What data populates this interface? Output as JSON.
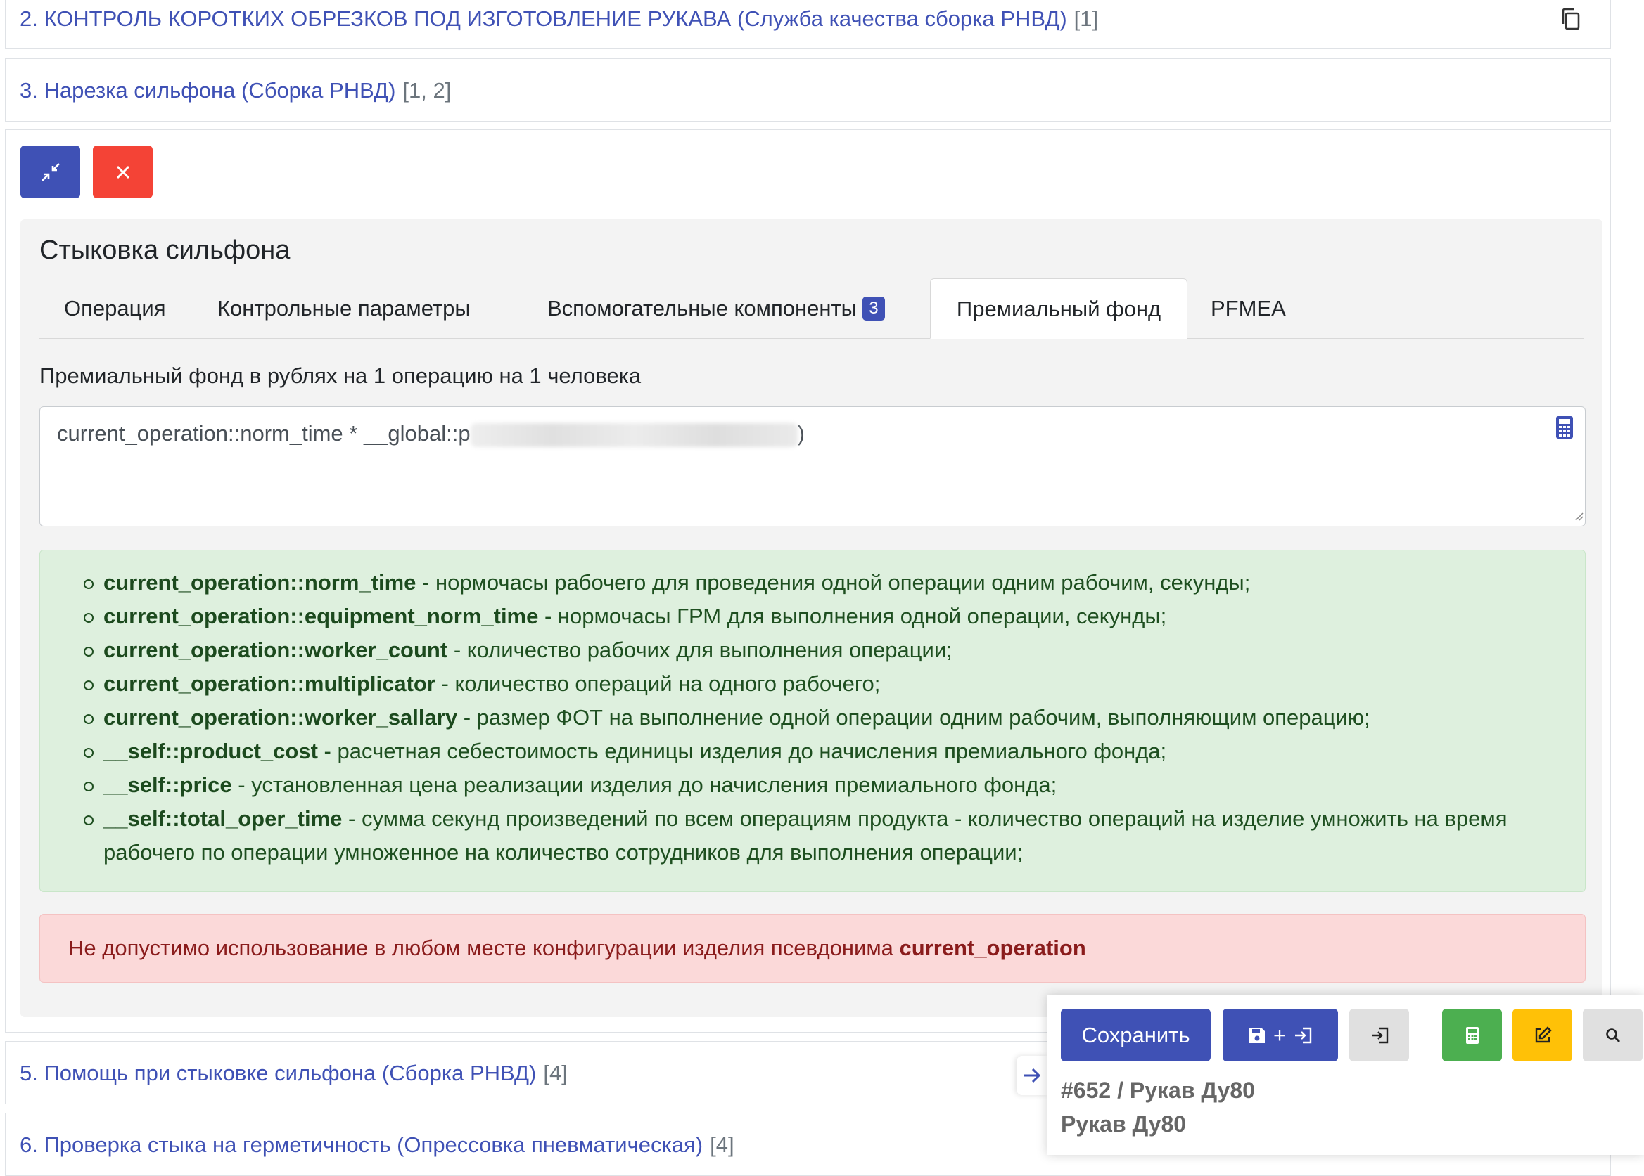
{
  "operations": [
    {
      "title": "2. КОНТРОЛЬ КОРОТКИХ ОБРЕЗКОВ ПОД ИЗГОТОВЛЕНИЕ РУКАВА (Служба качества сборка РНВД)",
      "refs": "[1]"
    },
    {
      "title": "3. Нарезка сильфона (Сборка РНВД)",
      "refs": "[1, 2]"
    },
    {
      "title": "5. Помощь при стыковке сильфона (Сборка РНВД)",
      "refs": "[4]"
    },
    {
      "title": "6. Проверка стыка на герметичность (Опрессовка пневматическая)",
      "refs": "[4]"
    }
  ],
  "panel": {
    "title": "Стыковка сильфона",
    "tabs": [
      {
        "label": "Операция"
      },
      {
        "label": "Контрольные параметры"
      },
      {
        "label": "Вспомогательные компоненты",
        "badge": "3"
      },
      {
        "label": "Премиальный фонд"
      },
      {
        "label": "PFMEA"
      }
    ],
    "active_tab": "Премиальный фонд",
    "field_label": "Премиальный фонд в рублях на 1 операцию на 1 человека",
    "formula_prefix": "current_operation::norm_time * __global::p",
    "formula_suffix": ")",
    "variables": [
      {
        "name": "current_operation::norm_time",
        "desc": " - нормочасы рабочего для проведения одной операции одним рабочим, секунды;"
      },
      {
        "name": "current_operation::equipment_norm_time",
        "desc": " - нормочасы ГРМ для выполнения одной операции, секунды;"
      },
      {
        "name": "current_operation::worker_count",
        "desc": " - количество рабочих для выполнения операции;"
      },
      {
        "name": "current_operation::multiplicator",
        "desc": " - количество операций на одного рабочего;"
      },
      {
        "name": "current_operation::worker_sallary",
        "desc": " - размер ФОТ на выполнение одной операции одним рабочим, выполняющим операцию;"
      },
      {
        "name": "__self::product_cost",
        "desc": " - расчетная себестоимость единицы изделия до начисления премиального фонда;"
      },
      {
        "name": "__self::price",
        "desc": " - установленная цена реализации изделия до начисления премиального фонда;"
      },
      {
        "name": "__self::total_oper_time",
        "desc": " - сумма секунд произведений по всем операциям продукта - количество операций на изделие умножить на время рабочего по операции умноженное на количество сотрудников для выполнения операции;"
      }
    ],
    "warning_text": "Не допустимо использование в любом месте конфигурации изделия псевдонима ",
    "warning_bold": "current_operation"
  },
  "floating_toolbar": {
    "save_label": "Сохранить",
    "save_add_label": "+",
    "product_id": "#652 / Рукав Ду80",
    "product_name": "Рукав Ду80"
  },
  "icons": {
    "copy": "copy-icon",
    "collapse": "compress-icon",
    "close": "close-icon",
    "calculator": "calculator-icon",
    "save": "floppy-disk-icon",
    "login": "sign-in-icon",
    "edit": "edit-icon",
    "search": "search-icon",
    "arrow": "arrow-right-icon"
  },
  "colors": {
    "primary": "#3f51b5",
    "danger": "#f44336",
    "success": "#4caf50",
    "warning": "#ffc107",
    "light": "#e0e0e0"
  }
}
